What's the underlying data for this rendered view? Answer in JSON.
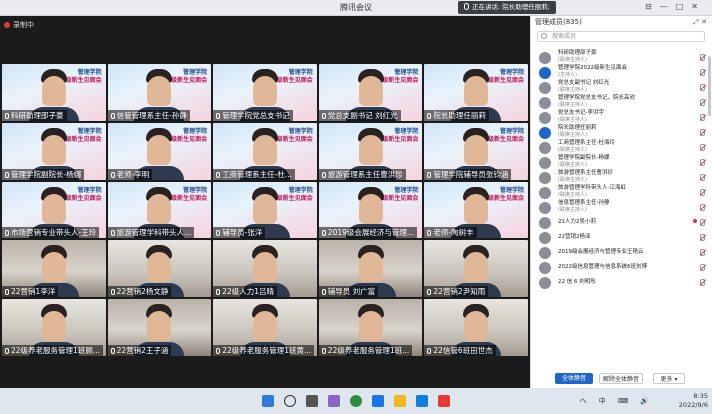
{
  "app_title": "腾讯会议",
  "speaking_text": "正在讲话: 院长助理任丽莉;",
  "recording_label": "录制中",
  "banner_text": {
    "school": "管理学院",
    "event": "2022级新生见面会"
  },
  "tiles": [
    {
      "name": "科研助理邵子豪",
      "bg": "banner"
    },
    {
      "name": "信管管理系主任-孙静",
      "bg": "banner"
    },
    {
      "name": "管理学院党总支书记",
      "bg": "banner"
    },
    {
      "name": "党总支副书记 刘红光",
      "bg": "banner"
    },
    {
      "name": "院长助理任丽莉",
      "bg": "banner"
    },
    {
      "name": "管理学院副院长-杨娜",
      "bg": "banner"
    },
    {
      "name": "老师-李明",
      "bg": "banner"
    },
    {
      "name": "工商管理系主任-杜...",
      "bg": "banner"
    },
    {
      "name": "旅游管理系主任曹洪珍",
      "bg": "banner"
    },
    {
      "name": "管理学院辅导员张钧涵",
      "bg": "banner"
    },
    {
      "name": "市场营销专业带头人-王玲",
      "bg": "banner"
    },
    {
      "name": "旅游管理学科带头人...",
      "bg": "banner"
    },
    {
      "name": "辅导员-张洋",
      "bg": "banner"
    },
    {
      "name": "2019级会展经济与管理...",
      "bg": "banner"
    },
    {
      "name": "老师-陶树丰",
      "bg": "banner"
    },
    {
      "name": "22营销1李洋",
      "bg": "room"
    },
    {
      "name": "22营销2杨文静",
      "bg": "room2"
    },
    {
      "name": "22级人力1吕晴",
      "bg": "room2"
    },
    {
      "name": "辅导员 刘广富",
      "bg": "room"
    },
    {
      "name": "22营销2尹知雨",
      "bg": "room2"
    },
    {
      "name": "22级养老服务管理1班顾...",
      "bg": "room2"
    },
    {
      "name": "22营销2王子涵",
      "bg": "room"
    },
    {
      "name": "22级养老服务管理1班黄...",
      "bg": "room2"
    },
    {
      "name": "22级养老服务管理1班...",
      "bg": "room"
    },
    {
      "name": "22信管6班田世杰",
      "bg": "room2"
    }
  ],
  "panel": {
    "title": "管理成员(835)",
    "search_placeholder": "搜索成员",
    "members": [
      {
        "name": "科研助理邵子豪",
        "role": "(联席主持人)"
      },
      {
        "name": "管理学院2022级新生见面会",
        "role": "(主持人)"
      },
      {
        "name": "党总支副书记 刘红光",
        "role": "(联席主持人)"
      },
      {
        "name": "管理学院党总支书记、院长高欣",
        "role": "(联席主持人)"
      },
      {
        "name": "党总支书记-李洪宇",
        "role": "(联席主持人)"
      },
      {
        "name": "院长助理任丽莉",
        "role": "(联席主持人)"
      },
      {
        "name": "工商管理系主任-杜海玲",
        "role": "(联席主持人)"
      },
      {
        "name": "管理学院副院长-杨娜",
        "role": "(联席主持人)"
      },
      {
        "name": "旅游管理系主任曹洪珍",
        "role": "(联席主持人)"
      },
      {
        "name": "旅游管理学科带头人-江海虹",
        "role": "(联席主持人)"
      },
      {
        "name": "信息管理系主任-孙静",
        "role": "(联席主持人)"
      },
      {
        "name": "21人力2吴小莉",
        "role": ""
      },
      {
        "name": "22营销2杨泽",
        "role": ""
      },
      {
        "name": "2019级会展经济与管理专业王艳云",
        "role": ""
      },
      {
        "name": "2022级信息管理与信息系统6班刘博",
        "role": ""
      },
      {
        "name": "22 信 6 刘明彤",
        "role": ""
      }
    ],
    "buttons": {
      "mute_all": "全体静音",
      "unmute_all": "解除全体静音",
      "more": "更多 ▾"
    }
  },
  "taskbar": {
    "tray": "ヘ 中 ⌨ 🔊",
    "time": "8:35",
    "date": "2022/9/6"
  }
}
